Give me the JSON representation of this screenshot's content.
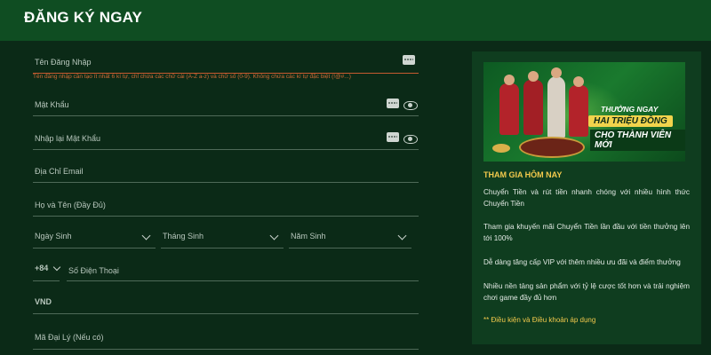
{
  "header": {
    "title": "ĐĂNG KÝ NGAY"
  },
  "form": {
    "username_label": "Tên Đăng Nhập",
    "username_error": "Tên đăng nhập cần tạo ít nhất 6 kí tự, chỉ chứa các chữ cái (A-Z a-z) và chữ số (0-9). Không chứa các kí tự đặc biệt (!@#...)",
    "password_label": "Mật Khẩu",
    "confirm_password_label": "Nhập lại Mật Khẩu",
    "email_label": "Địa Chỉ Email",
    "fullname_label": "Họ và Tên (Đầy Đủ)",
    "birth_day_label": "Ngày Sinh",
    "birth_month_label": "Tháng Sinh",
    "birth_year_label": "Năm Sinh",
    "phone_prefix": "+84",
    "phone_label": "Số Điện Thoại",
    "currency": "VND",
    "agent_code_label": "Mã Đại Lý (Nếu có)"
  },
  "panel": {
    "banner": {
      "line1": "THƯỞNG NGAY",
      "line2": "HAI TRIỆU ĐỒNG",
      "line3": "CHO THÀNH VIÊN MỚI"
    },
    "title": "THAM GIA HÔM NAY",
    "items": [
      "Chuyển Tiền và rút tiền nhanh chóng với nhiều hình thức Chuyển Tiền",
      "Tham gia khuyến mãi Chuyển Tiền lần đầu với tiền thưởng lên tới 100%",
      "Dễ dàng tăng cấp VIP với thêm nhiều ưu đãi và điểm thưởng",
      "Nhiều nền tảng sản phẩm với tỷ lệ cược tốt hơn và trải nghiệm chơi game đầy đủ hơn"
    ],
    "terms": "** Điều kiện và Điều khoản áp dụng"
  },
  "colors": {
    "header_bg": "#0f4d22",
    "page_bg": "#0b2a17",
    "accent": "#f2c94c",
    "error": "#d26b35"
  }
}
